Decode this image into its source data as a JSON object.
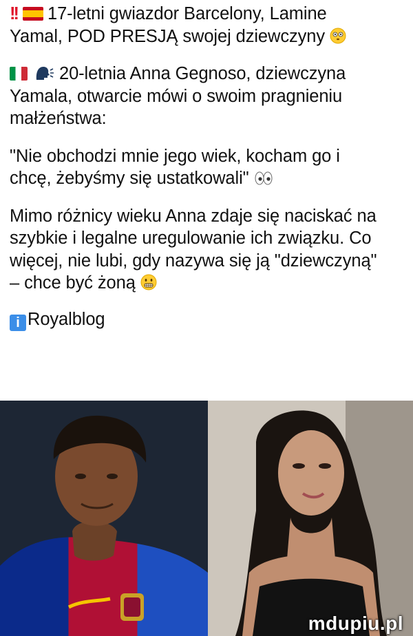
{
  "post": {
    "p1_line1": "17-letni gwiazdor Barcelony, Lamine",
    "p1_line2": "Yamal, POD PRESJĄ swojej dziewczyny",
    "p2_line1": "20-letnia Anna Gegnoso, dziewczyna",
    "p2_line2": "Yamala, otwarcie mówi o swoim pragnieniu",
    "p2_line3": "małżeństwa:",
    "p3_line1": "\"Nie obchodzi mnie jego wiek, kocham go i",
    "p3_line2": "chcę, żebyśmy się ustatkowali\"",
    "p4_line1": "Mimo różnicy wieku Anna zdaje się naciskać na",
    "p4_line2": "szybkie i legalne uregulowanie ich związku. Co",
    "p4_line3": "więcej, nie lubi, gdy nazywa się ją \"dziewczyną\"",
    "p4_line4": "– chce być żoną",
    "source": "Royalblog"
  },
  "icons": [
    "double-exclamation-icon",
    "spain-flag-icon",
    "flushed-face-icon",
    "italy-flag-icon",
    "speaking-head-icon",
    "eyes-icon",
    "grimacing-face-icon",
    "information-icon"
  ],
  "colors": {
    "text": "#111111",
    "exclamation": "#e0162b",
    "info": "#3b8ee8"
  },
  "watermark": "mdupiu.pl"
}
